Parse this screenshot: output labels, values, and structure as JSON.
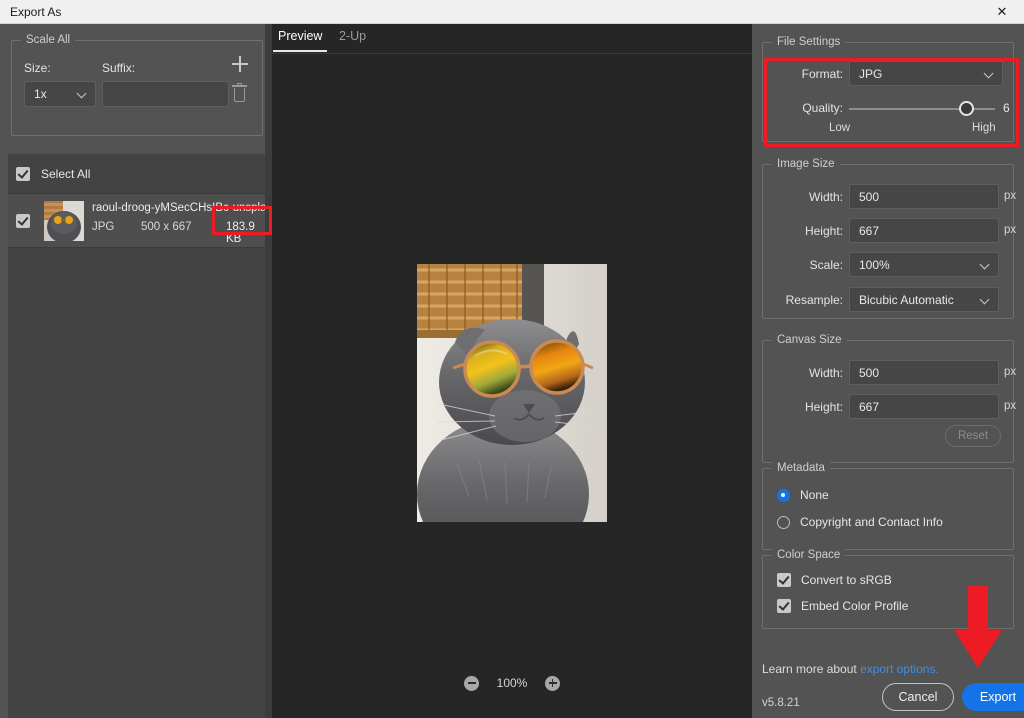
{
  "window": {
    "title": "Export As",
    "close_icon": "close-icon"
  },
  "left_panel": {
    "scale_all": {
      "legend": "Scale All",
      "size_label": "Size:",
      "suffix_label": "Suffix:",
      "size_value": "1x",
      "suffix_value": "",
      "suffix_placeholder": "",
      "add_icon": "plus-icon",
      "delete_icon": "trash-icon"
    },
    "file_list": {
      "select_all_label": "Select All",
      "select_all_checked": true,
      "items": [
        {
          "name": "raoul-droog-yMSecCHsIBc-unsplash",
          "format": "JPG",
          "dimensions": "500 x 667",
          "size": "183.9 KB",
          "checked": true,
          "selected": true
        }
      ]
    }
  },
  "preview": {
    "tabs": [
      {
        "label": "Preview",
        "active": true
      },
      {
        "label": "2-Up",
        "active": false
      }
    ],
    "zoom_out_icon": "zoom-out-icon",
    "zoom_in_icon": "zoom-in-icon",
    "zoom_level": "100%",
    "image_alt": "grey scottish fold cat wearing orange mirrored round sunglasses"
  },
  "right_panel": {
    "file_settings": {
      "legend": "File Settings",
      "format_label": "Format:",
      "format_value": "JPG",
      "quality_label": "Quality:",
      "quality_value": "6",
      "quality_min_label": "Low",
      "quality_max_label": "High",
      "quality_percent": 83
    },
    "image_size": {
      "legend": "Image Size",
      "width_label": "Width:",
      "width_value": "500",
      "width_unit": "px",
      "height_label": "Height:",
      "height_value": "667",
      "height_unit": "px",
      "scale_label": "Scale:",
      "scale_value": "100%",
      "resample_label": "Resample:",
      "resample_value": "Bicubic Automatic"
    },
    "canvas_size": {
      "legend": "Canvas Size",
      "width_label": "Width:",
      "width_value": "500",
      "width_unit": "px",
      "height_label": "Height:",
      "height_value": "667",
      "height_unit": "px",
      "reset_label": "Reset",
      "reset_disabled": true
    },
    "metadata": {
      "legend": "Metadata",
      "options": [
        {
          "label": "None",
          "selected": true
        },
        {
          "label": "Copyright and Contact Info",
          "selected": false
        }
      ]
    },
    "color_space": {
      "legend": "Color Space",
      "options": [
        {
          "label": "Convert to sRGB",
          "checked": true
        },
        {
          "label": "Embed Color Profile",
          "checked": true
        }
      ]
    },
    "footer": {
      "learn_prefix": "Learn more about ",
      "learn_link": "export options.",
      "version": "v5.8.21",
      "cancel_label": "Cancel",
      "export_label": "Export"
    }
  },
  "annotations": {
    "color": "#ed1c24",
    "highlight_file_size": true,
    "highlight_file_settings": true,
    "arrow_points_to": "export-button"
  }
}
